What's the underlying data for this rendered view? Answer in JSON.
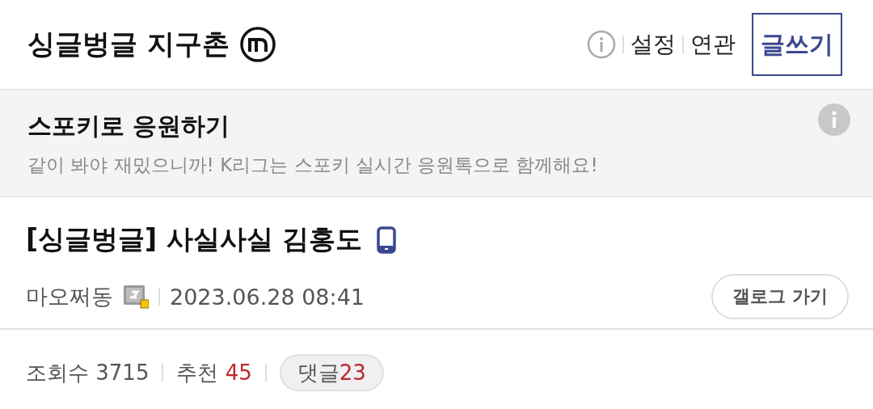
{
  "header": {
    "title": "싱글벙글 지구촌",
    "links": [
      "설정",
      "연관"
    ],
    "write_button": "글쓰기"
  },
  "banner": {
    "title": "스포키로 응원하기",
    "description": "같이 봐야 재밌으니까! K리그는 스포키 실시간 응원톡으로 함께해요!"
  },
  "post": {
    "title": "[싱글벙글] 사실사실 김홍도",
    "author": "마오쩌동",
    "date": "2023.06.28 08:41",
    "gallog_button": "갤로그 가기"
  },
  "stats": [
    {
      "kind": "plain",
      "label": "조회수",
      "value": "3715"
    },
    {
      "kind": "plain",
      "label": "추천",
      "value": "45"
    },
    {
      "kind": "pill",
      "label": "댓글",
      "value": "23"
    }
  ]
}
